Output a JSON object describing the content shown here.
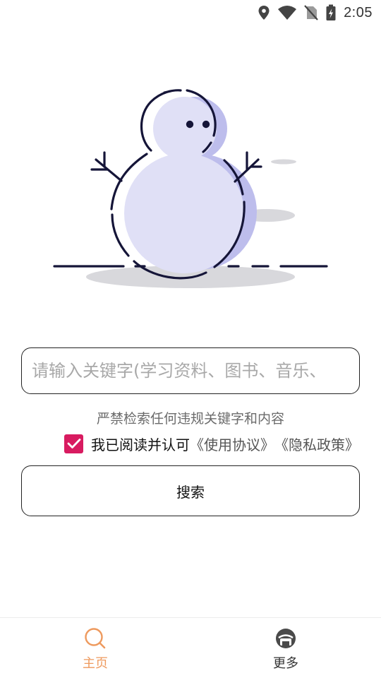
{
  "status_bar": {
    "time": "2:05",
    "icons": [
      "location-icon",
      "wifi-icon",
      "no-sim-icon",
      "battery-charging-icon"
    ]
  },
  "hero": {
    "illustration": "snowman-illustration"
  },
  "search": {
    "placeholder": "请输入关键字(学习资料、图书、音乐、"
  },
  "warning_text": "严禁检索任何违规关键字和内容",
  "agreement": {
    "checked": true,
    "text": "我已阅读并认可",
    "terms_link": "《使用协议》",
    "privacy_link": "《隐私政策》",
    "check_color": "#d81b60"
  },
  "search_button": {
    "label": "搜索"
  },
  "bottom_nav": {
    "items": [
      {
        "label": "主页",
        "icon": "search-icon",
        "active": true
      },
      {
        "label": "更多",
        "icon": "more-icon",
        "active": false
      }
    ],
    "active_color": "#ee9a5e"
  }
}
